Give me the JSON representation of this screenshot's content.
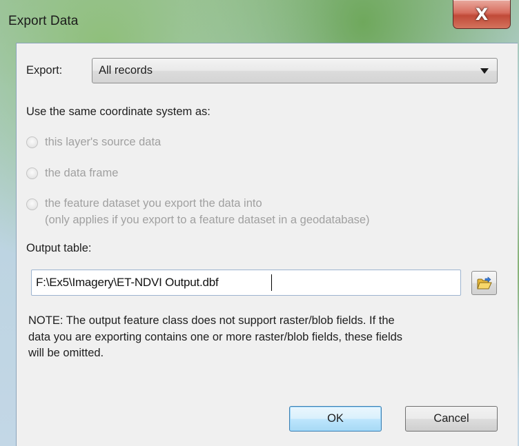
{
  "window": {
    "title": "Export Data",
    "close_glyph": "X"
  },
  "export": {
    "label": "Export:",
    "selected": "All records"
  },
  "coordinate": {
    "heading": "Use the same coordinate system as:",
    "options": [
      {
        "label": "this layer's source data",
        "enabled": false
      },
      {
        "label": "the data frame",
        "enabled": false
      },
      {
        "label": "the feature dataset you export the data into",
        "enabled": false
      }
    ],
    "option3_sublabel": "(only applies if you export to a feature dataset in a geodatabase)"
  },
  "output": {
    "label": "Output table:",
    "value": "F:\\Ex5\\Imagery\\ET-NDVI Output.dbf",
    "browse_icon": "open-folder-icon"
  },
  "note": {
    "line1": "NOTE: The output feature class does not support raster/blob fields. If the",
    "line2": "data you are exporting contains one or more raster/blob fields, these fields",
    "line3": "will be omitted."
  },
  "buttons": {
    "ok": "OK",
    "cancel": "Cancel"
  }
}
